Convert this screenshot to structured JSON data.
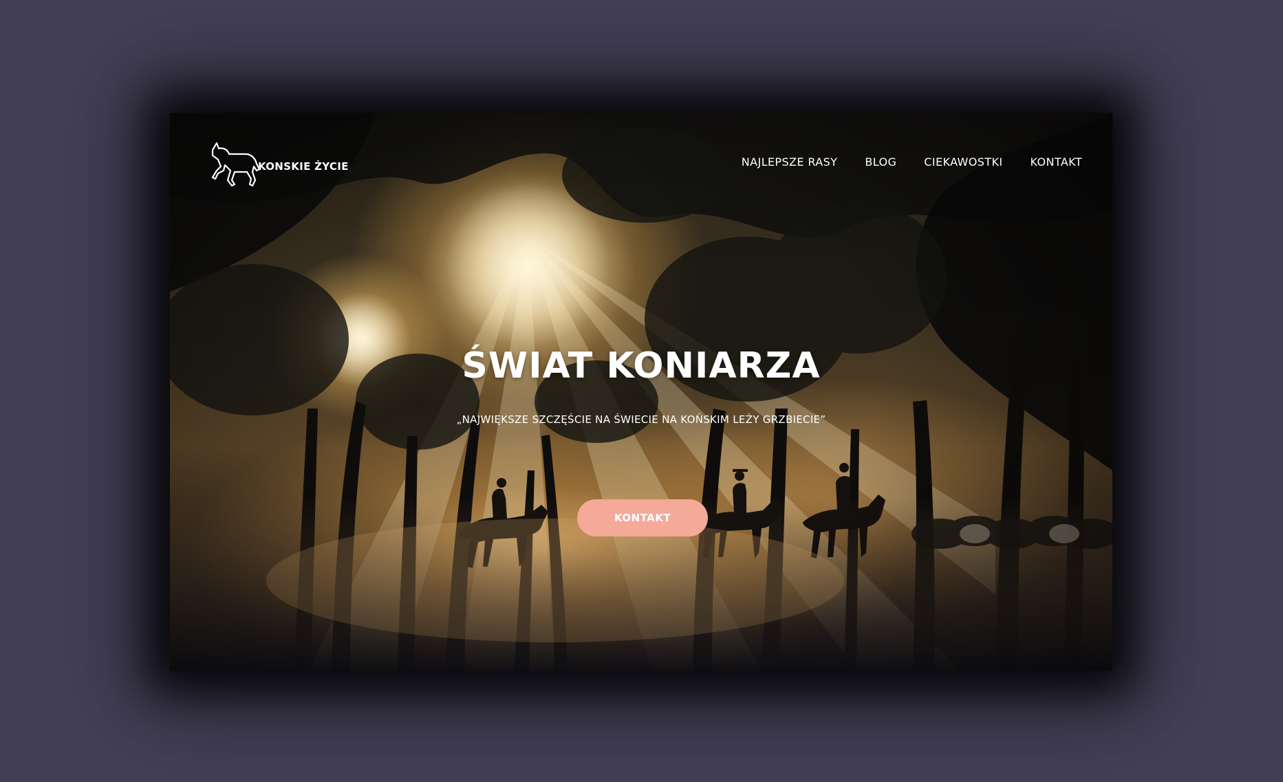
{
  "nav": {
    "logo_text": "KONSKIE ŻYCIE",
    "items": [
      {
        "label": "NAJLEPSZE RASY"
      },
      {
        "label": "BLOG"
      },
      {
        "label": "CIEKAWOSTKI"
      },
      {
        "label": "KONTAKT"
      }
    ]
  },
  "hero": {
    "title": "ŚWIAT KONIARZA",
    "quote": "„NAJWIĘKSZE SZCZĘŚCIE NA ŚWIECIE NA KOŃSKIM LEŻY GRZBIECIE”",
    "cta_label": "KONTAKT"
  },
  "colors": {
    "page_background": "#433f56",
    "cta_background": "#f4a999",
    "text": "#ffffff"
  },
  "icons": {
    "logo": "horse-outline-icon"
  },
  "images": {
    "hero_background": "sunlit forest with horse riders silhouettes and dust"
  }
}
